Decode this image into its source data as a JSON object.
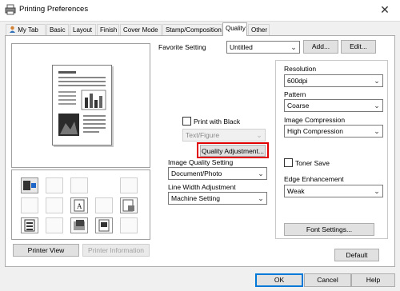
{
  "window": {
    "title": "Printing Preferences",
    "close_glyph": "✕"
  },
  "tabs": [
    {
      "label": "My Tab",
      "icon": "mytab-icon"
    },
    {
      "label": "Basic"
    },
    {
      "label": "Layout"
    },
    {
      "label": "Finish"
    },
    {
      "label": "Cover Mode"
    },
    {
      "label": "Stamp/Composition"
    },
    {
      "label": "Quality",
      "active": true
    },
    {
      "label": "Other"
    }
  ],
  "favorite": {
    "label": "Favorite Setting",
    "value": "Untitled",
    "add_label": "Add...",
    "edit_label": "Edit..."
  },
  "preview": {
    "printer_view_label": "Printer View",
    "printer_information_label": "Printer Information"
  },
  "print_with_black": {
    "label": "Print with Black",
    "checked": false,
    "sub_value": "Text/Figure"
  },
  "quality_adjustment_label": "Quality Adjustment...",
  "image_quality": {
    "label": "Image Quality Setting",
    "value": "Document/Photo"
  },
  "line_width": {
    "label": "Line Width Adjustment",
    "value": "Machine Setting"
  },
  "resolution": {
    "label": "Resolution",
    "value": "600dpi"
  },
  "pattern": {
    "label": "Pattern",
    "value": "Coarse"
  },
  "image_compression": {
    "label": "Image Compression",
    "value": "High Compression"
  },
  "toner_save": {
    "label": "Toner Save",
    "checked": false
  },
  "edge_enhancement": {
    "label": "Edge Enhancement",
    "value": "Weak"
  },
  "font_settings_label": "Font Settings...",
  "default_label": "Default",
  "footer": {
    "ok": "OK",
    "cancel": "Cancel",
    "help": "Help"
  },
  "colors": {
    "highlight": "#e00000",
    "focus": "#0078d7"
  }
}
